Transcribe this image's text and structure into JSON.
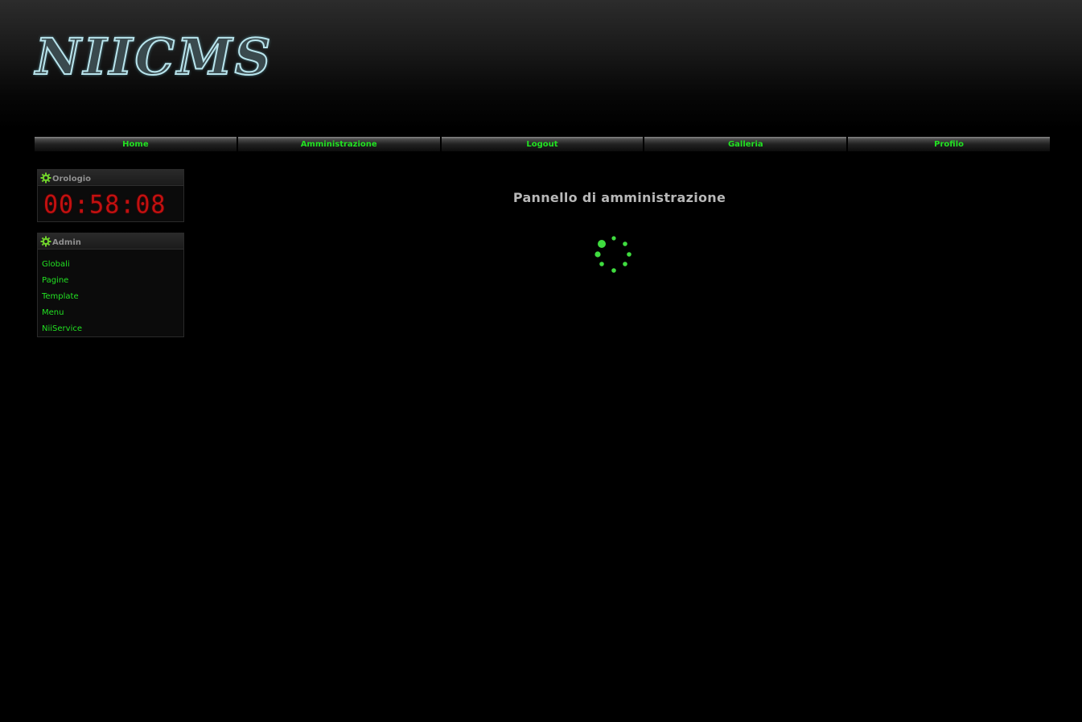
{
  "header": {
    "logo_text": "NIICMS"
  },
  "nav": {
    "items": [
      {
        "label": "Home"
      },
      {
        "label": "Amministrazione"
      },
      {
        "label": "Logout"
      },
      {
        "label": "Galleria"
      },
      {
        "label": "Profilo"
      }
    ]
  },
  "sidebar": {
    "clock": {
      "title": "Orologio",
      "time": "00:58:08"
    },
    "admin": {
      "title": "Admin",
      "items": [
        {
          "label": "Globali"
        },
        {
          "label": "Pagine"
        },
        {
          "label": "Template"
        },
        {
          "label": "Menu"
        },
        {
          "label": "NiiService"
        }
      ]
    }
  },
  "main": {
    "title": "Pannello di amministrazione",
    "loading_icon": "spinner-icon"
  },
  "colors": {
    "background": "#000000",
    "accent_green": "#22e022",
    "clock_red": "#c21010",
    "title_gray": "#b8b8b8"
  }
}
